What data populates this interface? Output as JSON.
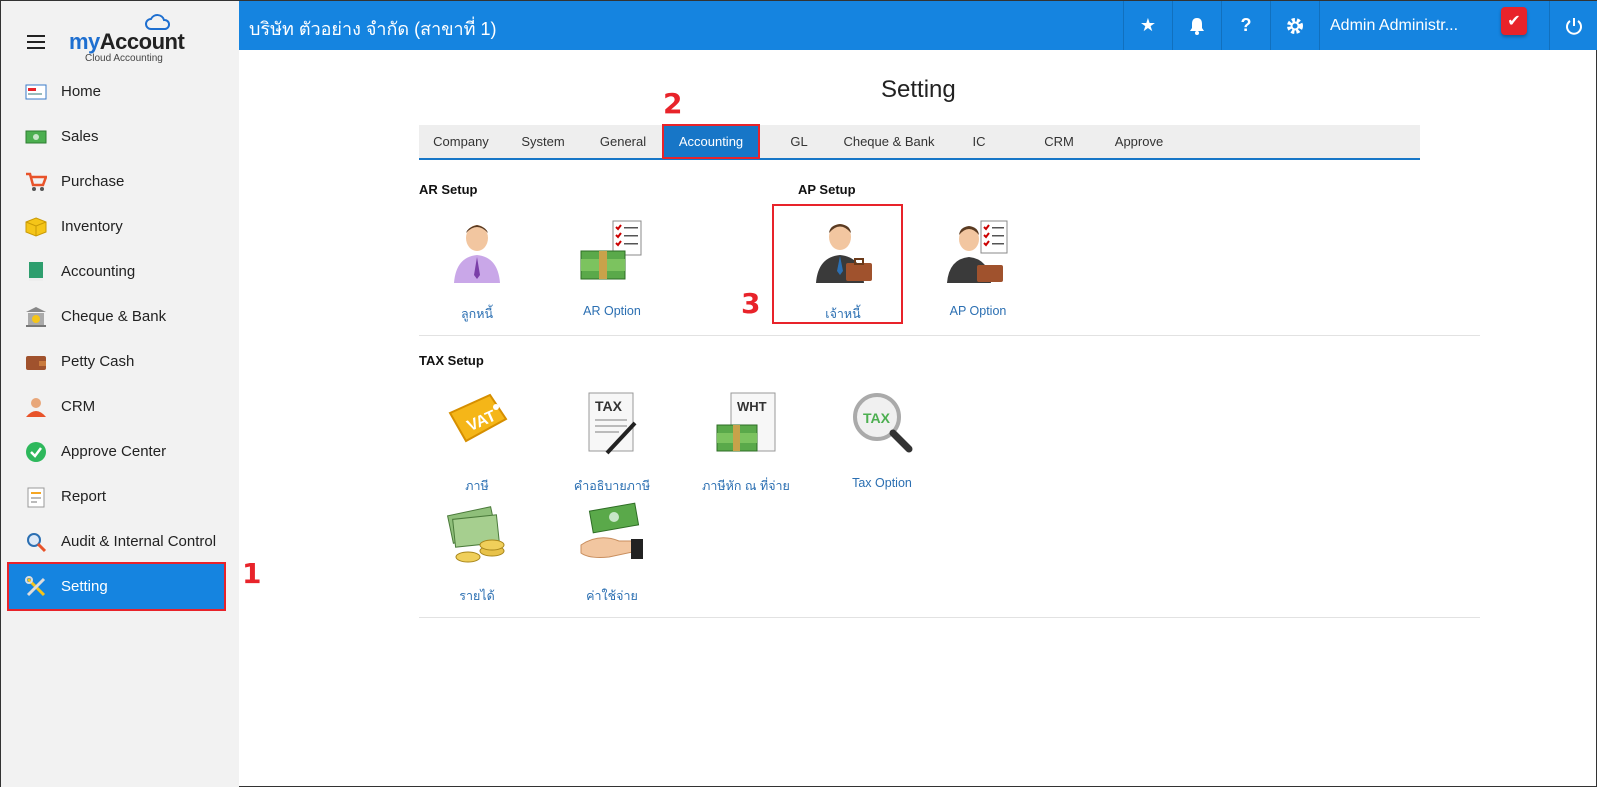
{
  "sidebar": {
    "brand_my": "my",
    "brand_account": "Account",
    "brand_tagline": "Cloud Accounting",
    "items": [
      {
        "label": "Home",
        "icon": "home-icon"
      },
      {
        "label": "Sales",
        "icon": "cash-icon"
      },
      {
        "label": "Purchase",
        "icon": "cart-icon"
      },
      {
        "label": "Inventory",
        "icon": "box-icon"
      },
      {
        "label": "Accounting",
        "icon": "book-icon"
      },
      {
        "label": "Cheque & Bank",
        "icon": "bank-icon"
      },
      {
        "label": "Petty Cash",
        "icon": "wallet-icon"
      },
      {
        "label": "CRM",
        "icon": "people-icon"
      },
      {
        "label": "Approve Center",
        "icon": "check-circle-icon"
      },
      {
        "label": "Report",
        "icon": "report-icon"
      },
      {
        "label": "Audit & Internal Control",
        "icon": "magnifier-icon"
      },
      {
        "label": "Setting",
        "icon": "tools-icon"
      }
    ],
    "active": "Setting"
  },
  "header": {
    "title": "บริษัท ตัวอย่าง จำกัด (สาขาที่ 1)",
    "user_name": "Admin Administr...",
    "icons": [
      "star-icon",
      "bell-icon",
      "help-icon",
      "gear-icon",
      "power-icon"
    ]
  },
  "main": {
    "page_title": "Setting",
    "tabs": [
      "Company",
      "System",
      "General",
      "Accounting",
      "GL",
      "Cheque & Bank",
      "IC",
      "CRM",
      "Approve"
    ],
    "active_tab": "Accounting",
    "ar_setup": {
      "title": "AR Setup",
      "tiles": [
        "ลูกหนี้",
        "AR Option"
      ]
    },
    "ap_setup": {
      "title": "AP Setup",
      "tiles": [
        "เจ้าหนี้",
        "AP Option"
      ]
    },
    "tax_setup": {
      "title": "TAX Setup",
      "tiles": [
        "ภาษี",
        "คำอธิบายภาษี",
        "ภาษีหัก ณ ที่จ่าย",
        "Tax Option",
        "รายได้",
        "ค่าใช้จ่าย"
      ]
    },
    "icon_text": {
      "vat": "VAT",
      "tax": "TAX",
      "wht": "WHT",
      "tax_lens": "TAX"
    }
  },
  "annotations": {
    "step1": "1",
    "step2": "2",
    "step3": "3"
  },
  "colors": {
    "primary": "#1584e0",
    "highlight": "#e8232a",
    "link": "#2b6fb2"
  }
}
